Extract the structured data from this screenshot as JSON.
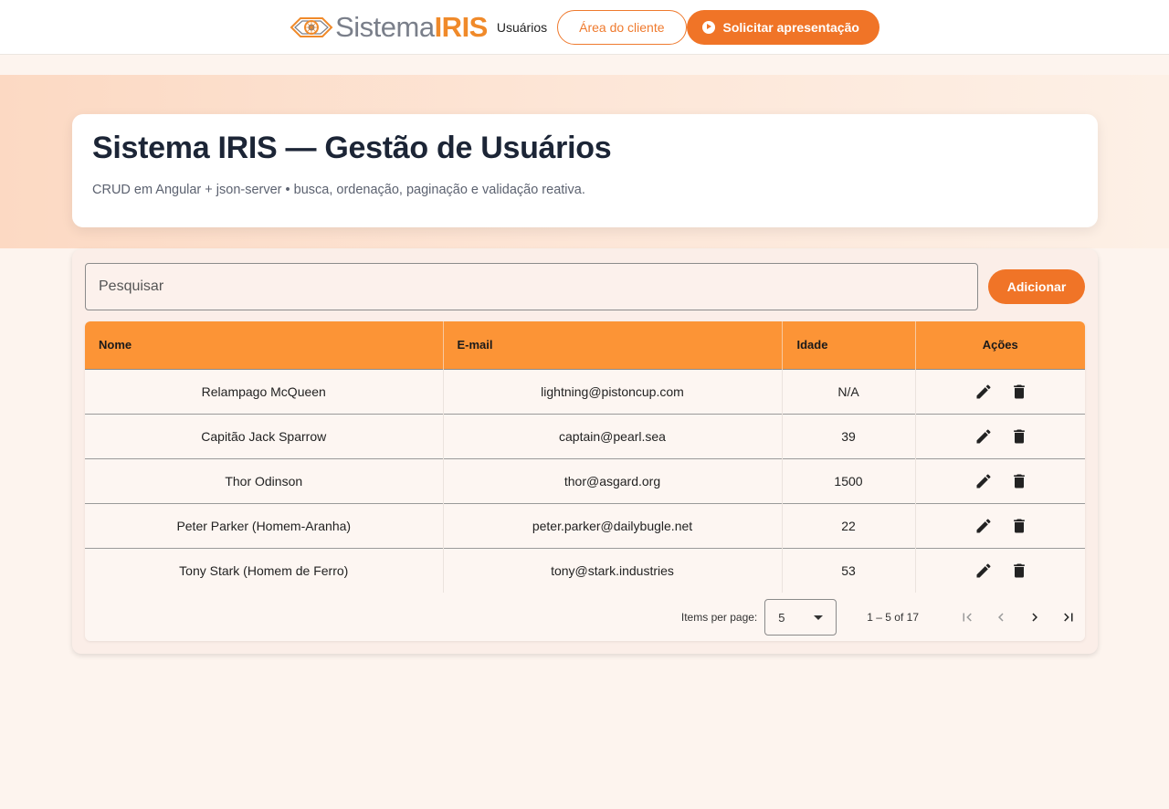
{
  "nav": {
    "logo_part1": "Sistema",
    "logo_part2": "IRIS",
    "link_users": "Usuários",
    "client_area": "Área do cliente",
    "request_demo": "Solicitar apresentação"
  },
  "hero": {
    "title": "Sistema IRIS — Gestão de Usuários",
    "subtitle": "CRUD em Angular + json-server • busca, ordenação, paginação e validação reativa."
  },
  "toolbar": {
    "search_placeholder": "Pesquisar",
    "add_label": "Adicionar"
  },
  "table": {
    "headers": {
      "name": "Nome",
      "email": "E-mail",
      "age": "Idade",
      "actions": "Ações"
    },
    "rows": [
      {
        "name": "Relampago McQueen",
        "email": "lightning@pistoncup.com",
        "age": "N/A"
      },
      {
        "name": "Capitão Jack Sparrow",
        "email": "captain@pearl.sea",
        "age": "39"
      },
      {
        "name": "Thor Odinson",
        "email": "thor@asgard.org",
        "age": "1500"
      },
      {
        "name": "Peter Parker (Homem-Aranha)",
        "email": "peter.parker@dailybugle.net",
        "age": "22"
      },
      {
        "name": "Tony Stark (Homem de Ferro)",
        "email": "tony@stark.industries",
        "age": "53"
      }
    ]
  },
  "paginator": {
    "items_per_page_label": "Items per page:",
    "page_size": "5",
    "range": "1 – 5 of 17"
  },
  "colors": {
    "accent": "#f07427",
    "header_orange": "#fc9436",
    "background": "#fdf4ee"
  },
  "icons": [
    "logo-mark-icon",
    "play-icon",
    "edit-icon",
    "delete-icon",
    "first-page-icon",
    "previous-page-icon",
    "next-page-icon",
    "last-page-icon",
    "dropdown-caret-icon"
  ]
}
